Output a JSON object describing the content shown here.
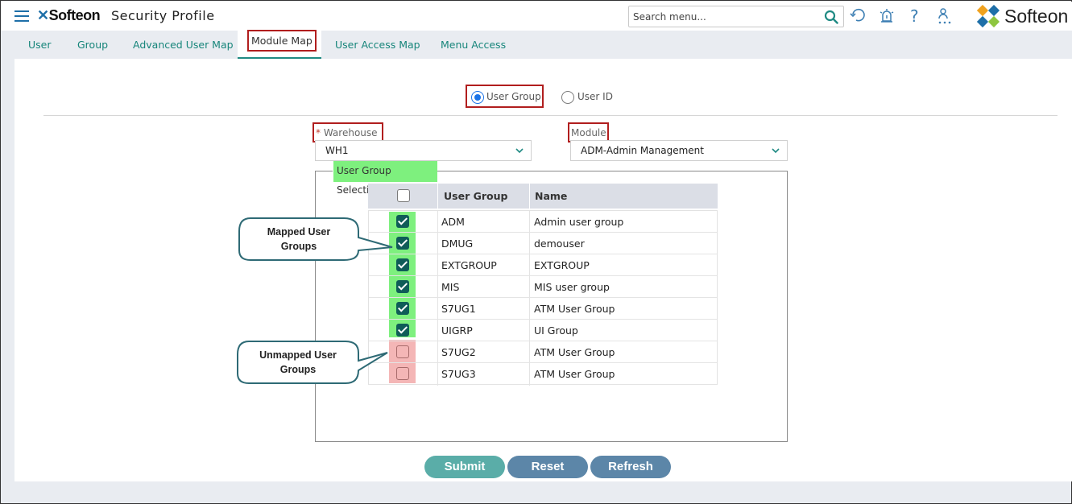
{
  "header": {
    "brand": "Softeon",
    "app_title": "Security Profile",
    "search_placeholder": "Search menu...",
    "logo_text": "Softeon",
    "icons": [
      "menu-icon",
      "search-icon",
      "refresh-icon",
      "alarm-icon",
      "help-icon",
      "user-network-icon"
    ]
  },
  "tabs": [
    {
      "label": "User",
      "active": false
    },
    {
      "label": "Group",
      "active": false
    },
    {
      "label": "Advanced User Map",
      "active": false
    },
    {
      "label": "Module Map",
      "active": true
    },
    {
      "label": "User Access Map",
      "active": false
    },
    {
      "label": "Menu Access",
      "active": false
    }
  ],
  "mode": {
    "options": [
      {
        "label": "User Group",
        "selected": true
      },
      {
        "label": "User ID",
        "selected": false
      }
    ]
  },
  "form": {
    "warehouse": {
      "required_mark": "*",
      "label": "Warehouse",
      "value": "WH1"
    },
    "module": {
      "label": "Module",
      "value": "ADM-Admin Management"
    }
  },
  "selection": {
    "legend": "User Group Selection",
    "columns": [
      "User Group",
      "Name"
    ],
    "rows": [
      {
        "group": "ADM",
        "name": "Admin user group",
        "checked": true
      },
      {
        "group": "DMUG",
        "name": "demouser",
        "checked": true
      },
      {
        "group": "EXTGROUP",
        "name": "EXTGROUP",
        "checked": true
      },
      {
        "group": "MIS",
        "name": "MIS user group",
        "checked": true
      },
      {
        "group": "S7UG1",
        "name": "ATM User Group",
        "checked": true
      },
      {
        "group": "UIGRP",
        "name": "UI Group",
        "checked": true
      },
      {
        "group": "S7UG2",
        "name": "ATM User Group",
        "checked": false
      },
      {
        "group": "S7UG3",
        "name": "ATM User Group",
        "checked": false
      }
    ]
  },
  "callouts": {
    "mapped": [
      "Mapped User",
      "Groups"
    ],
    "unmapped": [
      "Unmapped User",
      "Groups"
    ]
  },
  "actions": {
    "submit": "Submit",
    "reset": "Reset",
    "refresh": "Refresh"
  },
  "colors": {
    "accent": "#1f8a83",
    "highlight_red": "#b11e1e",
    "mapped_green": "#7ef07e",
    "unmapped_pink": "#f4b6b6",
    "checkbox_checked": "#0f5c58"
  }
}
